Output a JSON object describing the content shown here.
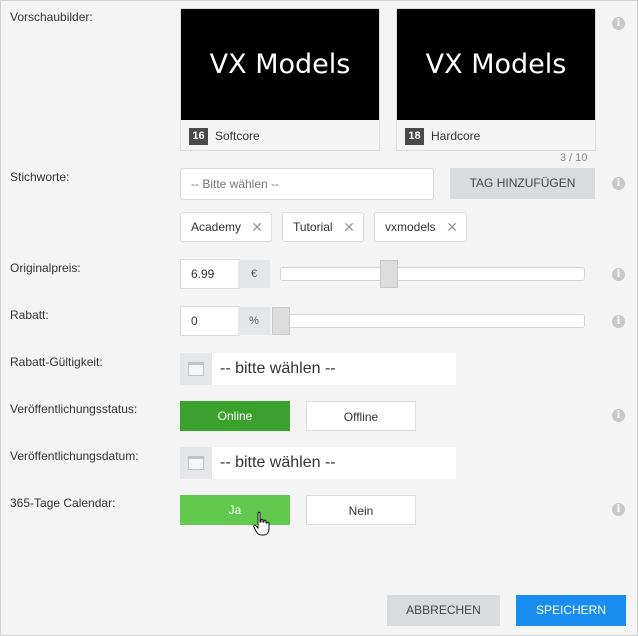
{
  "labels": {
    "preview": "Vorschaubilder:",
    "tags": "Stichworte:",
    "original_price": "Originalpreis:",
    "discount": "Rabatt:",
    "discount_validity": "Rabatt-Gültigkeit:",
    "publish_status": "Veröffentlichungsstatus:",
    "publish_date": "Veröffentlichungsdatum:",
    "calendar": "365-Tage Calendar:"
  },
  "thumbnails": [
    {
      "image_text": "VX Models",
      "badge": "16",
      "caption": "Softcore"
    },
    {
      "image_text": "VX Models",
      "badge": "18",
      "caption": "Hardcore"
    }
  ],
  "tags": {
    "counter": "3 / 10",
    "placeholder": "-- Bitte wählen --",
    "add_button": "TAG HINZUFÜGEN",
    "items": [
      "Academy",
      "Tutorial",
      "vxmodels"
    ],
    "remove_glyph": "✕"
  },
  "price": {
    "value": "6.99",
    "unit": "€",
    "slider_fraction": 0.35
  },
  "discount": {
    "value": "0",
    "unit": "%",
    "slider_fraction": 0.0
  },
  "discount_validity": {
    "placeholder": "-- bitte wählen --"
  },
  "publish_status": {
    "online": "Online",
    "offline": "Offline",
    "selected": "online"
  },
  "publish_date": {
    "placeholder": "-- bitte wählen --"
  },
  "calendar": {
    "yes": "Ja",
    "no": "Nein",
    "selected": "yes"
  },
  "footer": {
    "cancel": "ABBRECHEN",
    "save": "SPEICHERN"
  },
  "info_glyph": "i",
  "colors": {
    "green_active": "#3aa22c",
    "green_hover": "#62c94f",
    "blue_primary": "#1a8ef0"
  }
}
